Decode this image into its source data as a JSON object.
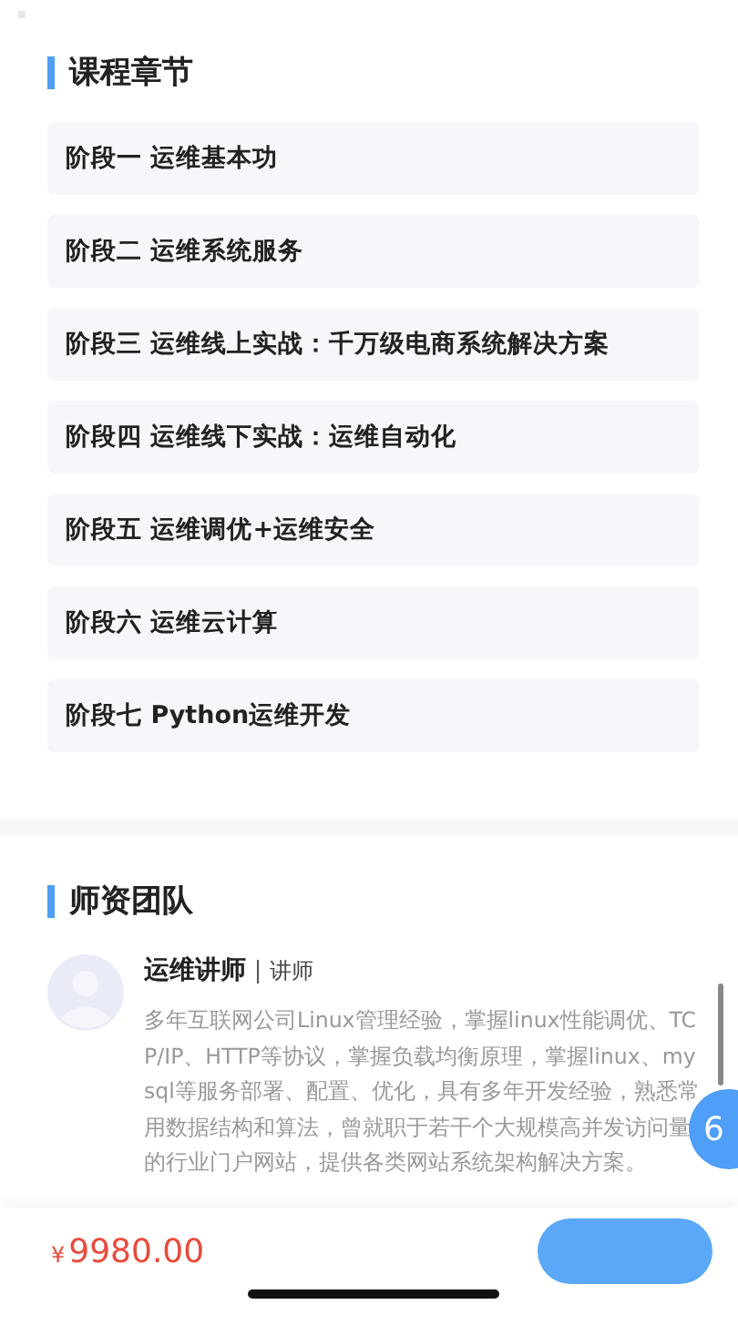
{
  "chapters": {
    "title": "课程章节",
    "items": [
      {
        "label": "阶段一 运维基本功"
      },
      {
        "label": "阶段二 运维系统服务"
      },
      {
        "label": "阶段三 运维线上实战：千万级电商系统解决方案"
      },
      {
        "label": "阶段四 运维线下实战：运维自动化"
      },
      {
        "label": "阶段五 运维调优+运维安全"
      },
      {
        "label": "阶段六 运维云计算"
      },
      {
        "label": "阶段七 Python运维开发"
      }
    ]
  },
  "teachers": {
    "title": "师资团队",
    "members": [
      {
        "name": "运维讲师",
        "role": "讲师",
        "bio": "多年互联网公司Linux管理经验，掌握linux性能调优、TCP/IP、HTTP等协议，掌握负载均衡原理，掌握linux、mysql等服务部署、配置、优化，具有多年开发经验，熟悉常用数据结构和算法，曾就职于若干个大规模高并发访问量的行业门户网站，提供各类网站系统架构解决方案。"
      }
    ]
  },
  "floating_badge": "6",
  "bottom_bar": {
    "price": "9980.00",
    "currency": "¥"
  }
}
